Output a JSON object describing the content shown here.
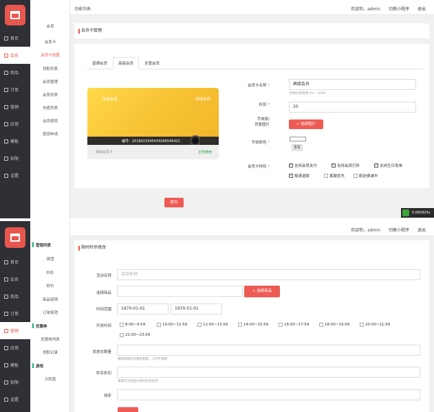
{
  "panel1": {
    "sidebar": {
      "items": [
        {
          "label": "首页",
          "icon": "home-icon"
        },
        {
          "label": "会员",
          "icon": "user-icon"
        },
        {
          "label": "商品",
          "icon": "goods-icon"
        },
        {
          "label": "订单",
          "icon": "order-icon"
        },
        {
          "label": "营销",
          "icon": "marketing-icon"
        },
        {
          "label": "应用",
          "icon": "app-icon"
        },
        {
          "label": "模板",
          "icon": "template-icon"
        },
        {
          "label": "权限",
          "icon": "permission-icon"
        },
        {
          "label": "设置",
          "icon": "settings-icon"
        }
      ]
    },
    "submenu": [
      "会员",
      "会员卡",
      "会员卡设置",
      "领取列表",
      "会员管理",
      "会员列表",
      "充值列表",
      "会员提现",
      "提现申请"
    ],
    "topbar": {
      "breadcrumb": "功能列表",
      "welcome": "欢迎你，admin",
      "switch": "切换小程序",
      "logout": "退出"
    },
    "card_title": "会员卡管理",
    "tabs": [
      "普通会员",
      "高级会员",
      "至尊会员"
    ],
    "vip_card": {
      "name": "高级会员",
      "number": "编号：2018021645434346545421",
      "level": "高级会员卡",
      "status": "正常使用"
    },
    "form": {
      "name_label": "会员卡名称",
      "name_value": "高级会员",
      "name_hint": "折扣比例范围 0% - 100%",
      "discount_label": "折扣",
      "discount_value": "20",
      "bg_label_line1": "字体颜/",
      "bg_label_line2": "背景图片",
      "select_image": "+ 选择图片",
      "font_color_label": "字体颜色",
      "reset_btn": "重置",
      "privilege_label": "会员卡特权",
      "privileges": [
        "支持会员支付",
        "支持会员打折",
        "支持生日免单",
        "极速退款",
        "客服优先",
        "配送费减半"
      ]
    },
    "submit": "提交",
    "watermark": "0.065925s"
  },
  "panel2": {
    "sidebar": {
      "items": [
        {
          "label": "首页",
          "icon": "home-icon"
        },
        {
          "label": "会员",
          "icon": "user-icon"
        },
        {
          "label": "商品",
          "icon": "goods-icon"
        },
        {
          "label": "订单",
          "icon": "order-icon"
        },
        {
          "label": "营销",
          "icon": "marketing-icon"
        },
        {
          "label": "应用",
          "icon": "app-icon"
        },
        {
          "label": "模板",
          "icon": "template-icon"
        },
        {
          "label": "权限",
          "icon": "permission-icon"
        },
        {
          "label": "设置",
          "icon": "settings-icon"
        }
      ]
    },
    "submenu": {
      "group1": "营销列表",
      "group1_items": [
        "拼团",
        "秒杀",
        "砍价",
        "商品促销",
        "订单促销"
      ],
      "group2": "优惠券",
      "group2_items": [
        "优惠券列表",
        "领取记录"
      ],
      "group3": "游戏",
      "group3_items": [
        "大转盘"
      ]
    },
    "topbar": {
      "welcome": "欢迎你，admin",
      "switch": "切换小程序",
      "logout": "退出"
    },
    "card_title": "限时秒杀修改",
    "form": {
      "activity_name_label": "活动名称",
      "activity_name_placeholder": "活动名称",
      "select_goods_label": "选择商品",
      "select_goods_btn": "+ 选择商品",
      "time_range_label": "时间范围",
      "start_date": "1970-01-01",
      "end_date": "1970-01-01",
      "open_time_label": "开放时间",
      "slots": [
        "8:00~9:59",
        "10:00~11:59",
        "12:00~13:59",
        "14:00~15:59",
        "16:00~17:59",
        "18:00~19:59",
        "20:00~21:59",
        "22:00~23:59"
      ],
      "total_label": "发放总数量",
      "total_hint": "限制领取的优惠券数量，-1为不限制",
      "discount_label": "秒杀折扣",
      "discount_hint": "请填写为商品价格的折扣比例",
      "sort_label": "排序"
    }
  }
}
